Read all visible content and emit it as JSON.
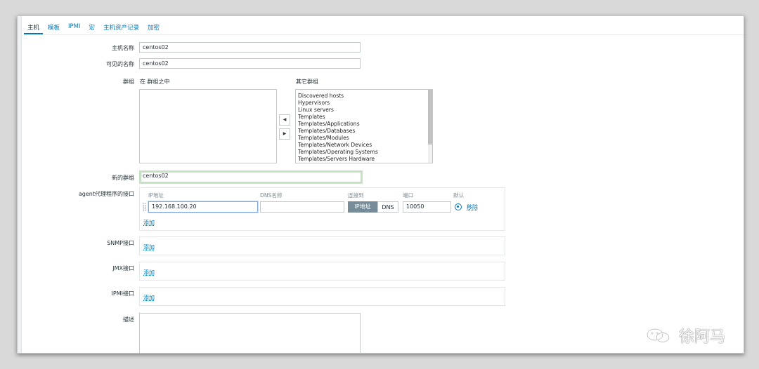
{
  "tabs": [
    "主机",
    "模板",
    "IPMI",
    "宏",
    "主机资产记录",
    "加密"
  ],
  "host_name": {
    "label": "主机名称",
    "value": "centos02"
  },
  "visible_name": {
    "label": "可见的名称",
    "value": "centos02"
  },
  "groups": {
    "label": "群组",
    "in_groups_label": "在 群组之中",
    "other_groups_label": "其它群组",
    "other_groups": [
      "Discovered hosts",
      "Hypervisors",
      "Linux servers",
      "Templates",
      "Templates/Applications",
      "Templates/Databases",
      "Templates/Modules",
      "Templates/Network Devices",
      "Templates/Operating Systems",
      "Templates/Servers Hardware"
    ]
  },
  "new_group": {
    "label": "新的群组",
    "value": "centos02"
  },
  "agent_interfaces": {
    "label": "agent代理程序的接口",
    "columns": {
      "ip": "IP地址",
      "dns": "DNS名称",
      "connect": "连接到",
      "port": "端口",
      "default": "默认"
    },
    "row": {
      "ip": "192.168.100.20",
      "dns": "",
      "connect_ip": "IP地址",
      "connect_dns": "DNS",
      "port": "10050",
      "remove": "移除"
    },
    "add": "添加"
  },
  "snmp": {
    "label": "SNMP接口",
    "add": "添加"
  },
  "jmx": {
    "label": "JMX接口",
    "add": "添加"
  },
  "ipmi": {
    "label": "IPMI接口",
    "add": "添加"
  },
  "description": {
    "label": "描述",
    "value": ""
  },
  "watermark": "徐阿马",
  "colors": {
    "accent": "#0275b8",
    "segment_active": "#768d99",
    "new_group_border": "#c5e0c4"
  },
  "icons": {
    "move_left": "triangle-left-icon",
    "move_right": "triangle-right-icon",
    "drag": "drag-handle-icon",
    "watermark": "wechat-logo-icon"
  }
}
